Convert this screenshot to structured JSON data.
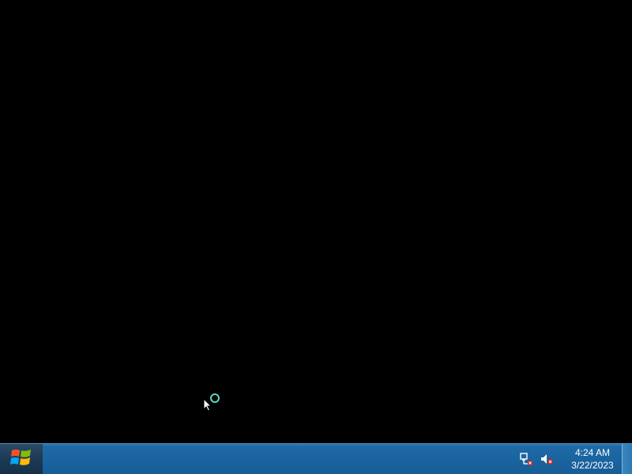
{
  "taskbar": {
    "clock_time": "4:24 AM",
    "clock_date": "3/22/2023"
  },
  "icons": {
    "start": "windows-logo-icon",
    "network": "network-disconnected-icon",
    "volume": "speaker-muted-icon",
    "cursor": "busy-arrow-cursor-icon"
  },
  "colors": {
    "desktop_background": "#000000",
    "taskbar": "#1a64a0"
  }
}
